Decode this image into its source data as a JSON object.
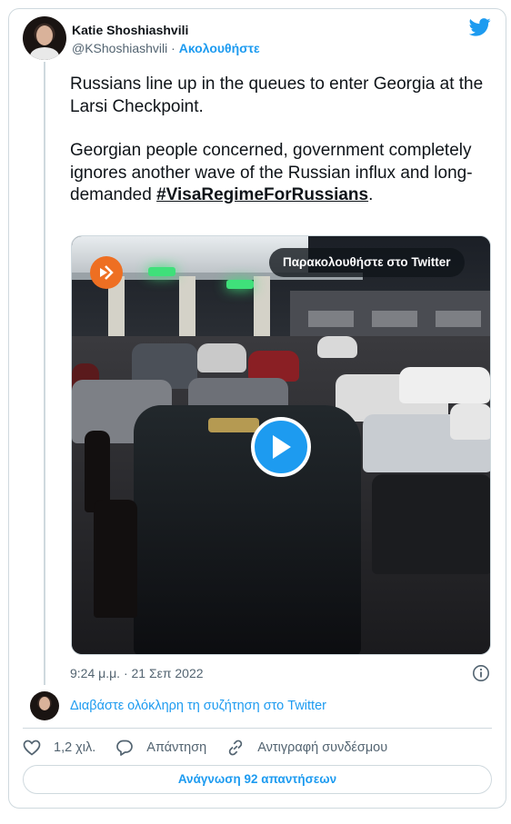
{
  "author": {
    "name": "Katie Shoshiashvili",
    "handle": "@KShoshiashvili",
    "separator": "·",
    "follow_label": "Ακολουθήστε"
  },
  "tweet": {
    "paragraph1": "Russians line up in the queues to enter Georgia at the Larsi Checkpoint.",
    "paragraph2": "Georgian people concerned, government completely ignores another wave of the Russian influx and long-demanded ",
    "hashtag": "#VisaRegimeForRussians",
    "after_hashtag": "."
  },
  "media": {
    "watch_label": "Παρακολουθήστε στο Twitter",
    "icon": "play-icon"
  },
  "timestamp": "9:24 μ.μ. · 21 Σεπ 2022",
  "thread": {
    "read_label": "Διαβάστε ολόκληρη τη συζήτηση στο Twitter"
  },
  "actions": {
    "likes": "1,2 χιλ.",
    "reply_label": "Απάντηση",
    "copy_link_label": "Αντιγραφή συνδέσμου"
  },
  "read_replies_label": "Ανάγνωση 92 απαντήσεων",
  "colors": {
    "accent": "#1d9bf0",
    "text": "#0f1419",
    "muted": "#536471",
    "border": "#cfd9de"
  }
}
